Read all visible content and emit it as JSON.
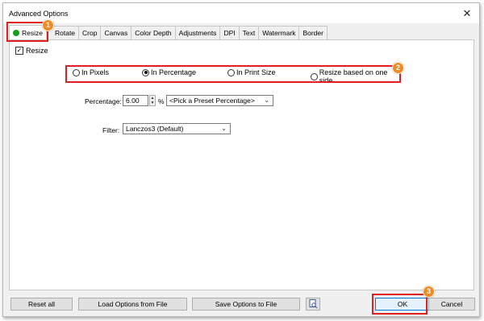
{
  "window": {
    "title": "Advanced Options",
    "close_glyph": "✕"
  },
  "tabs": [
    {
      "label": "Resize",
      "active": true
    },
    {
      "label": "Rotate"
    },
    {
      "label": "Crop"
    },
    {
      "label": "Canvas"
    },
    {
      "label": "Color Depth"
    },
    {
      "label": "Adjustments"
    },
    {
      "label": "DPI"
    },
    {
      "label": "Text"
    },
    {
      "label": "Watermark"
    },
    {
      "label": "Border"
    }
  ],
  "resize": {
    "checkbox_label": "Resize",
    "checked": true,
    "radio_options": [
      {
        "label": "In Pixels",
        "selected": false
      },
      {
        "label": "In Percentage",
        "selected": true
      },
      {
        "label": "In Print Size",
        "selected": false
      },
      {
        "label": "Resize based on one side",
        "selected": false
      }
    ],
    "percentage_label": "Percentage:",
    "percentage_value": "6.00",
    "percent_sign": "%",
    "preset_placeholder": "<Pick a Preset Percentage>",
    "filter_label": "Filter:",
    "filter_value": "Lanczos3 (Default)"
  },
  "buttons": {
    "reset_all": "Reset all",
    "load_options": "Load Options from File",
    "save_options": "Save Options to File",
    "ok": "OK",
    "cancel": "Cancel"
  },
  "callouts": [
    "1",
    "2",
    "3"
  ],
  "colors": {
    "callout_border": "#e02020",
    "badge": "#f08a24",
    "active_dot": "#14a01a"
  }
}
